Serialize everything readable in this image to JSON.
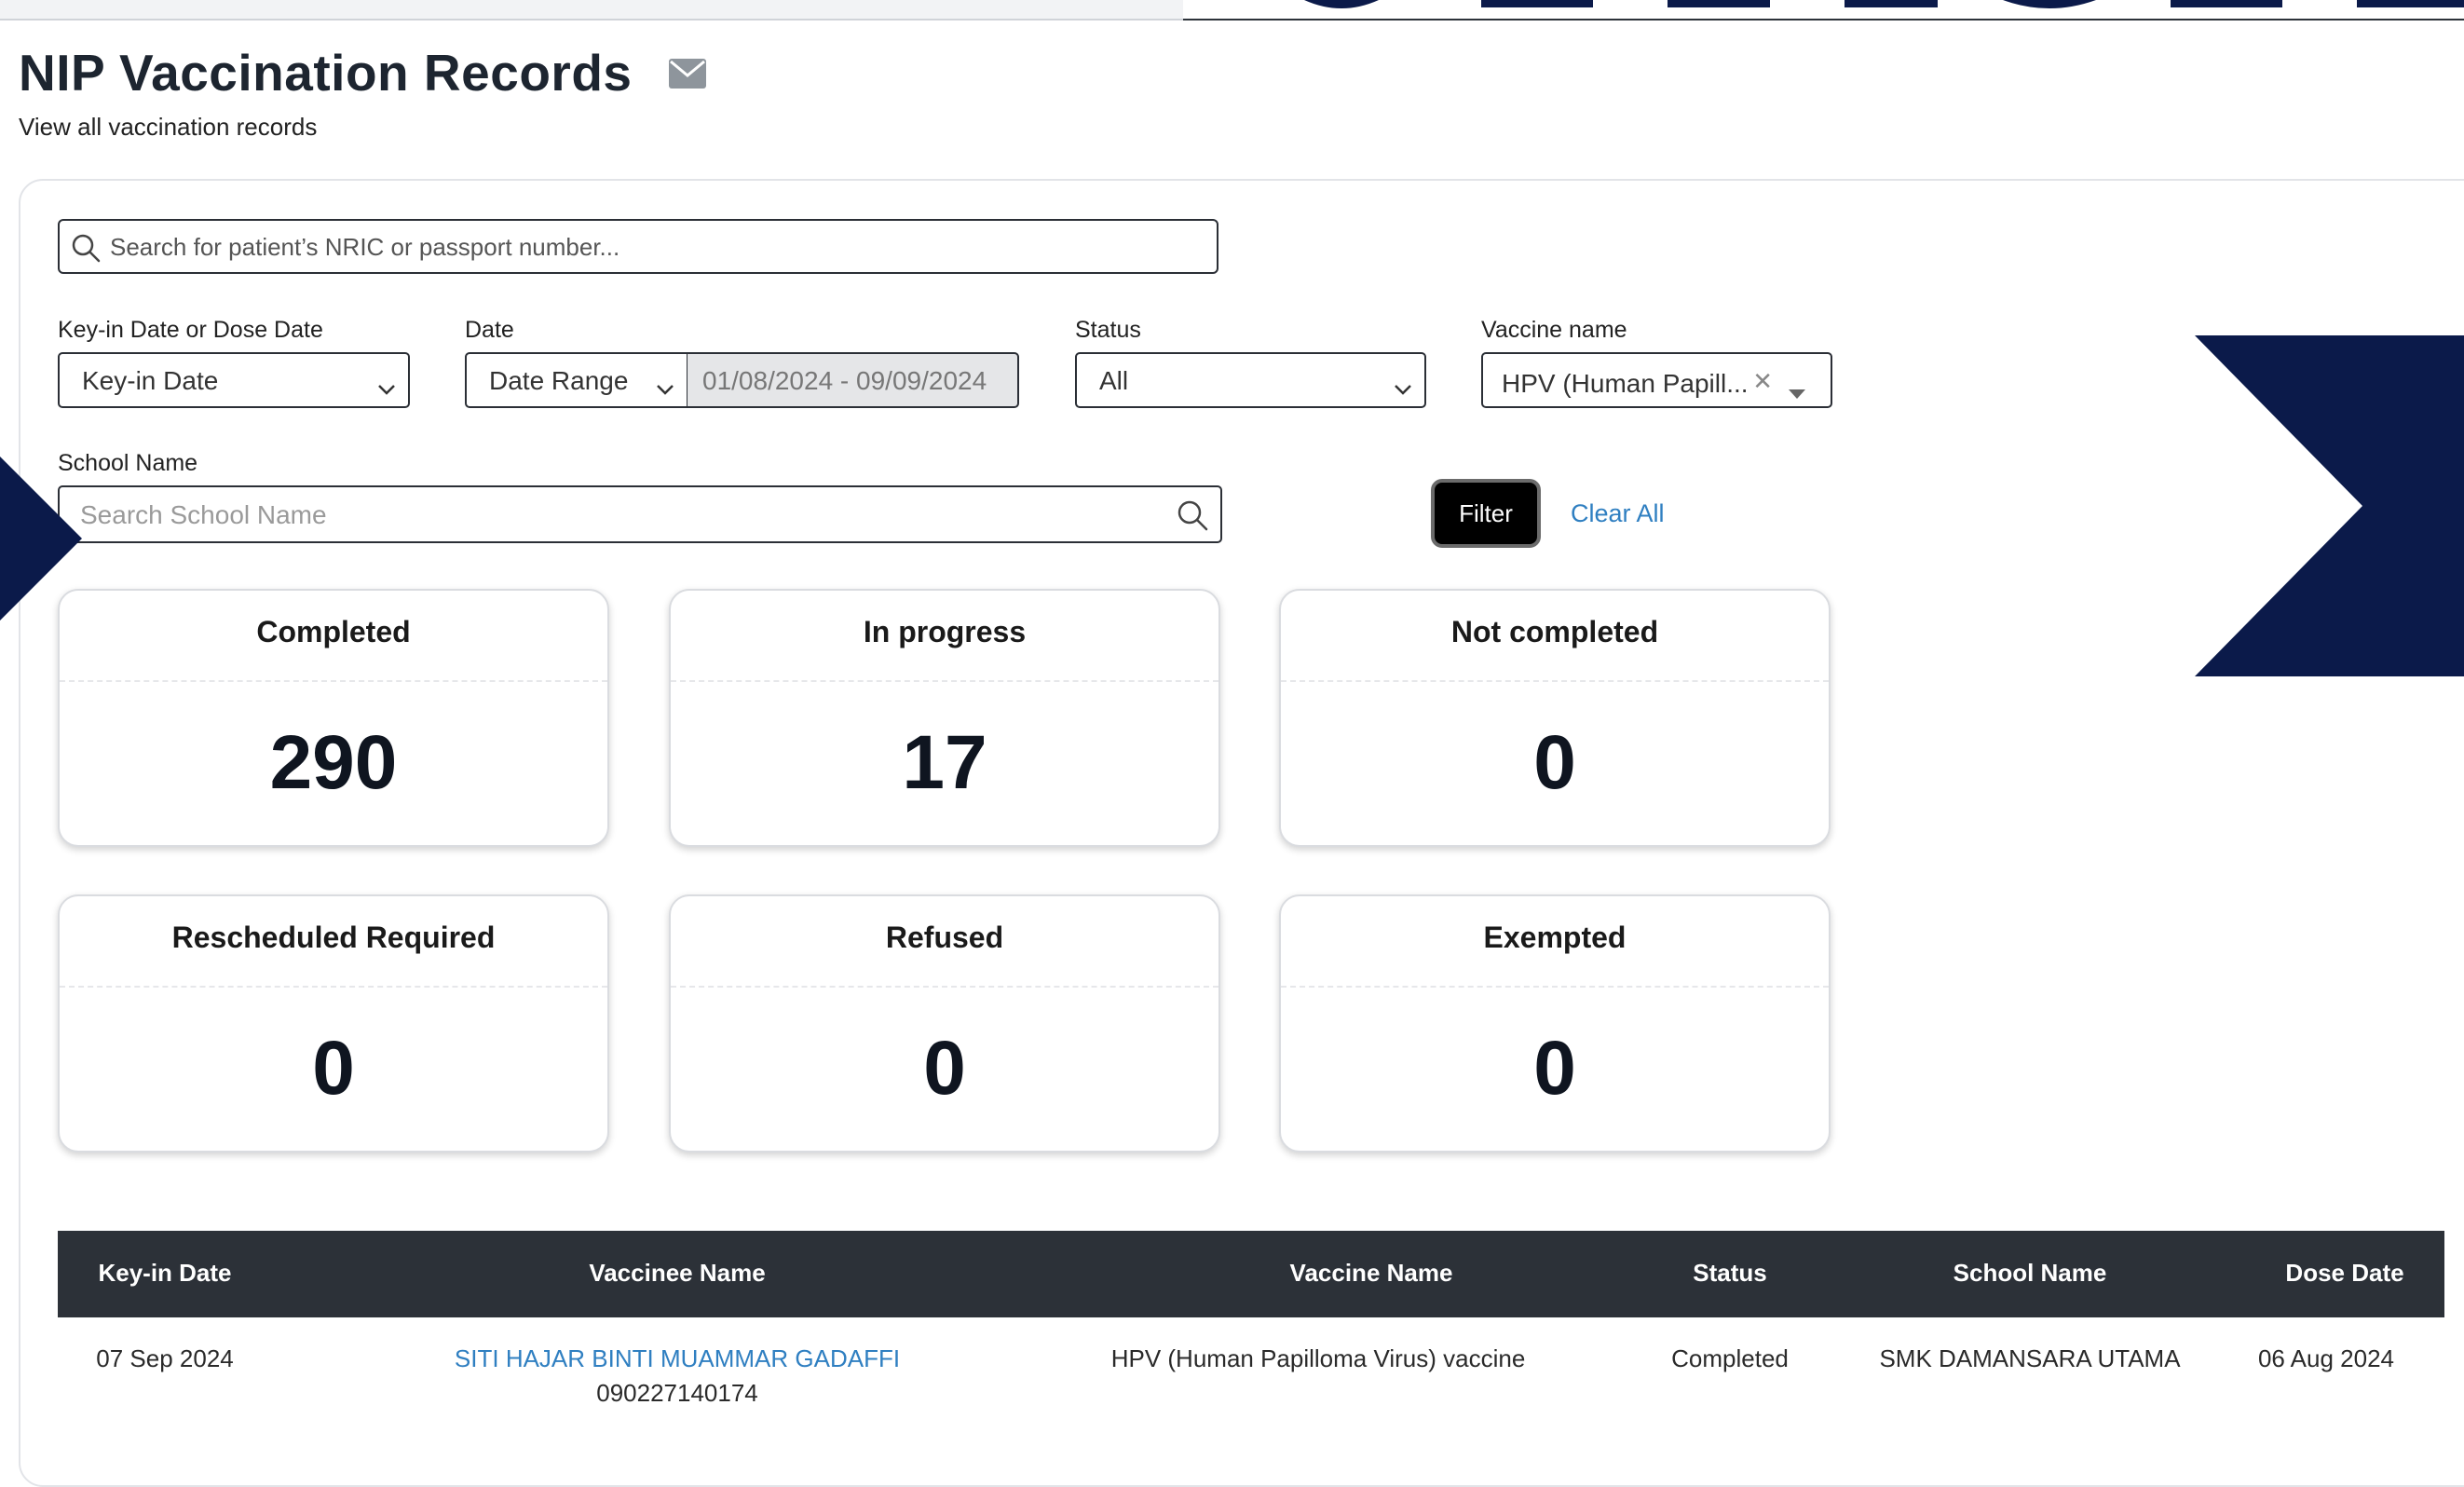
{
  "page": {
    "title": "NIP Vaccination Records",
    "subtitle": "View all vaccination records",
    "mail_icon": "envelope-icon"
  },
  "search": {
    "placeholder": "Search for patient’s NRIC or passport number..."
  },
  "filters": {
    "date_type": {
      "label": "Key-in Date or Dose Date",
      "value": "Key-in Date"
    },
    "date": {
      "label": "Date",
      "mode": "Date Range",
      "range": "01/08/2024 - 09/09/2024"
    },
    "status": {
      "label": "Status",
      "value": "All"
    },
    "vaccine": {
      "label": "Vaccine name",
      "value": "HPV (Human Papill...",
      "clear_glyph": "✕"
    },
    "school": {
      "label": "School Name",
      "placeholder": "Search School Name"
    },
    "filter_button": "Filter",
    "clear_all": "Clear All"
  },
  "summary_cards": [
    {
      "title": "Completed",
      "count": "290"
    },
    {
      "title": "In progress",
      "count": "17"
    },
    {
      "title": "Not completed",
      "count": "0"
    },
    {
      "title": "Rescheduled Required",
      "count": "0"
    },
    {
      "title": "Refused",
      "count": "0"
    },
    {
      "title": "Exempted",
      "count": "0"
    }
  ],
  "table": {
    "columns": [
      "Key-in Date",
      "Vaccinee Name",
      "Vaccine Name",
      "Status",
      "School Name",
      "Dose Date"
    ],
    "rows": [
      {
        "key_in_date": "07 Sep 2024",
        "vaccinee_name": "SITI HAJAR BINTI MUAMMAR GADAFFI",
        "vaccinee_id": "090227140174",
        "vaccine_name": "HPV (Human Papilloma Virus) vaccine",
        "status": "Completed",
        "school_name": "SMK DAMANSARA UTAMA",
        "dose_date": "06 Aug 2024"
      }
    ]
  },
  "colors": {
    "navy_decoration": "#0b1a4a",
    "table_header": "#2c3138",
    "link": "#2f7fc1",
    "filter_button": "#000000"
  }
}
